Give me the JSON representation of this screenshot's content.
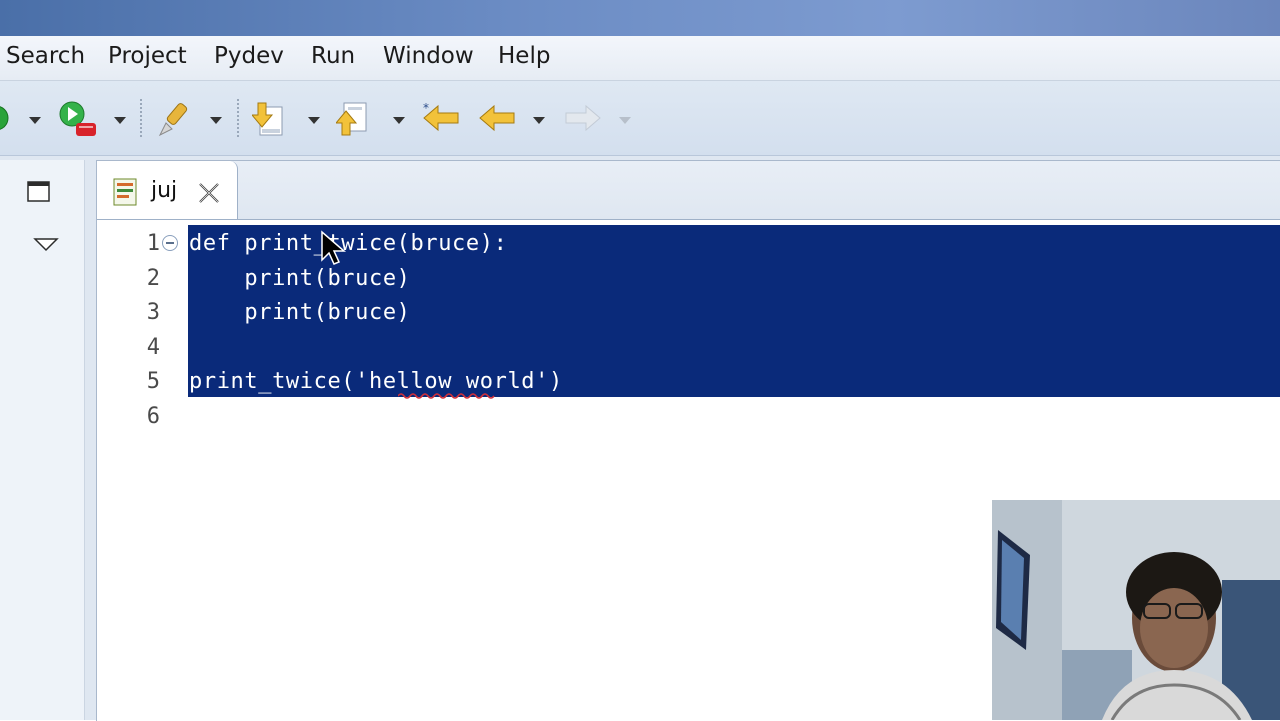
{
  "menu": {
    "items": [
      "Search",
      "Project",
      "Pydev",
      "Run",
      "Window",
      "Help"
    ]
  },
  "toolbar": {
    "icons": [
      "run-icon",
      "debug-icon",
      "brush-icon",
      "next-annotation-icon",
      "previous-annotation-icon",
      "last-edit-icon",
      "back-icon",
      "forward-icon"
    ]
  },
  "editor": {
    "tab_label": "juj",
    "line_numbers": [
      "1",
      "2",
      "3",
      "4",
      "5",
      "6"
    ],
    "lines": [
      "def print_twice(bruce):",
      "    print(bruce)",
      "    print(bruce)",
      "",
      "print_twice('hellow world')",
      ""
    ],
    "selection_color": "#0a2a7a"
  }
}
